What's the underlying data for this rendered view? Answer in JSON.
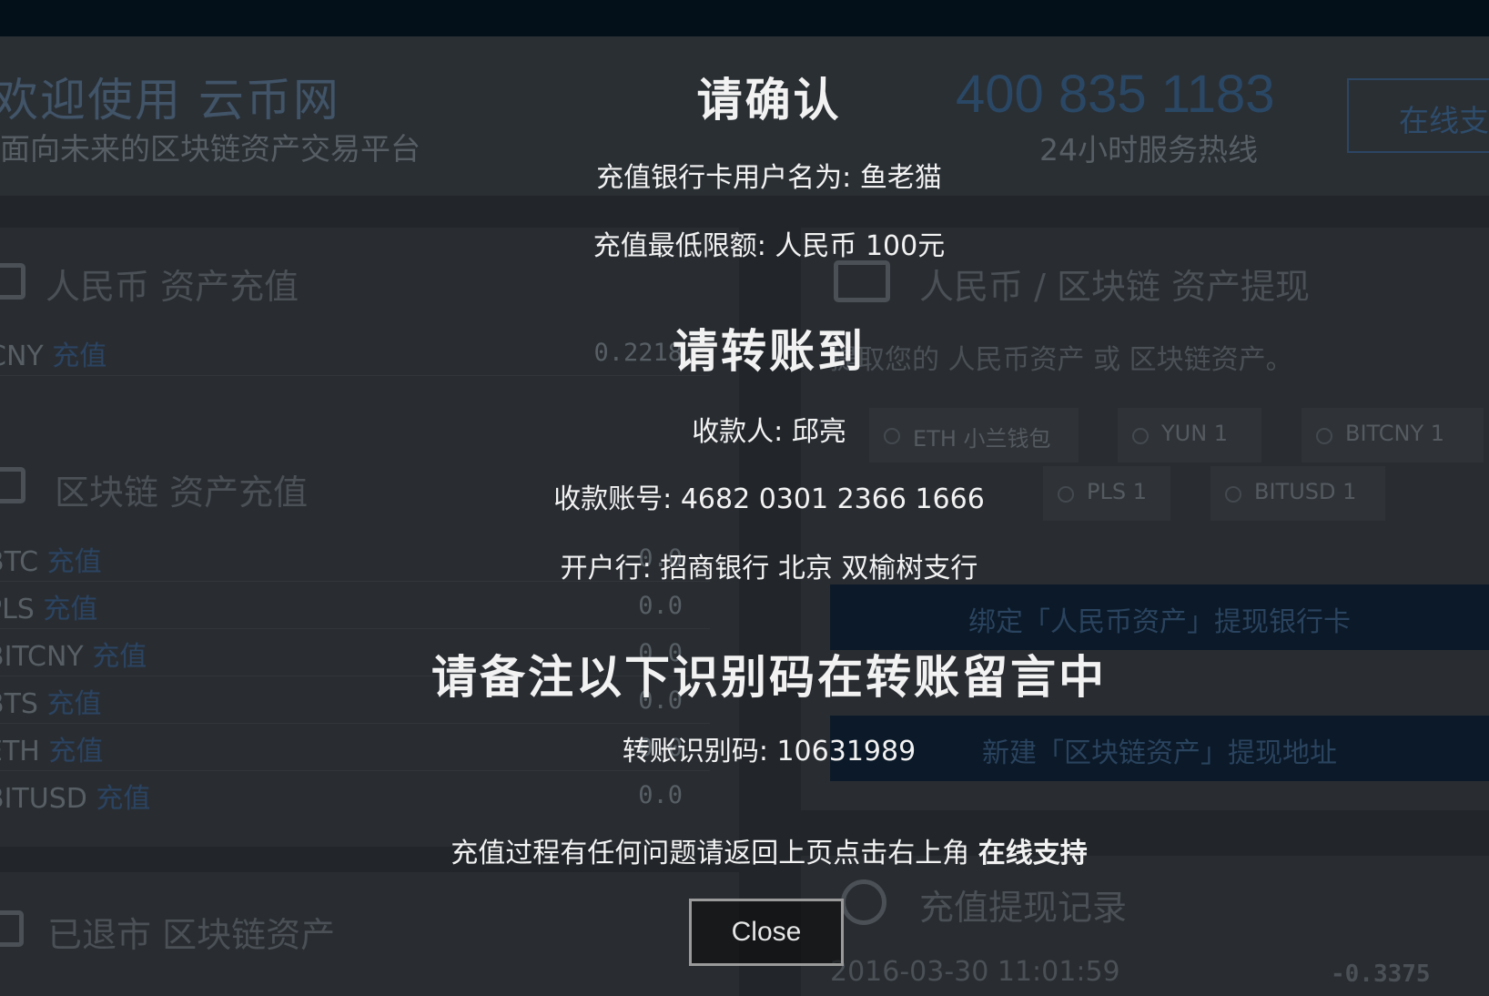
{
  "background": {
    "site": {
      "welcome": "欢迎使用 云币网",
      "slogan": "面向未来的区块链资产交易平台",
      "hotline": "400 835 1183",
      "hotline_label": "24小时服务热线",
      "support_label": "在线支持"
    },
    "cny_deposit": {
      "title": "人民币 资产充值",
      "row_label": "CNY",
      "row_link": "充值",
      "row_value": "0.2218"
    },
    "chain_deposit": {
      "title": "区块链 资产充值",
      "rows": [
        {
          "label": "BTC",
          "link": "充值",
          "value": "0.0"
        },
        {
          "label": "PLS",
          "link": "充值",
          "value": "0.0"
        },
        {
          "label": "BITCNY",
          "link": "充值",
          "value": "0.0"
        },
        {
          "label": "BTS",
          "link": "充值",
          "value": "0.0"
        },
        {
          "label": "ETH",
          "link": "充值",
          "value": "0.0"
        },
        {
          "label": "BITUSD",
          "link": "充值",
          "value": "0.0"
        }
      ]
    },
    "delisted": {
      "title": "已退市 区块链资产"
    },
    "withdraw": {
      "title": "人民币 / 区块链 资产提现",
      "desc": "提取您的 人民币资产 或 区块链资产。",
      "tags": [
        "ETH 小兰钱包",
        "YUN 1",
        "BITCNY 1",
        "PLS 1",
        "BITUSD 1"
      ],
      "bind_bank_btn": "绑定「人民币资产」提现银行卡",
      "new_address_btn": "新建「区块链资产」提现地址"
    },
    "history": {
      "title": "充值提现记录",
      "date": "2016-03-30 11:01:59",
      "amount": "-0.3375"
    }
  },
  "modal": {
    "confirm_heading": "请确认",
    "account_name_line": "充值银行卡用户名为: 鱼老猫",
    "min_amount_line": "充值最低限额: 人民币 100元",
    "transfer_heading": "请转账到",
    "payee_line": "收款人: 邱亮",
    "account_no_line": "收款账号: 4682 0301 2366 1666",
    "bank_line": "开户行: 招商银行 北京 双榆树支行",
    "memo_heading": "请备注以下识别码在转账留言中",
    "code_line": "转账识别码: 10631989",
    "help_prefix": "充值过程有任何问题请返回上页点击右上角 ",
    "help_strong": "在线支持",
    "close_label": "Close"
  }
}
